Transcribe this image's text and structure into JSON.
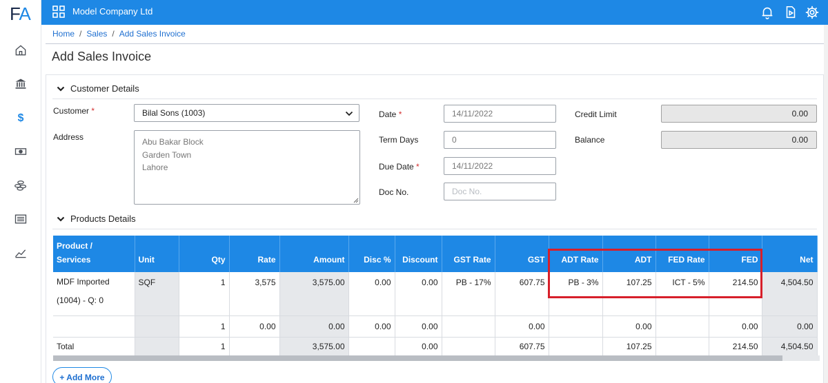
{
  "app": {
    "logo_f": "F",
    "logo_a": "A",
    "company": "Model Company Ltd"
  },
  "nav_icons": [
    "home-icon",
    "bank-icon",
    "dollar-icon",
    "cash-icon",
    "coins-icon",
    "list-icon",
    "chart-icon"
  ],
  "breadcrumb": {
    "home": "Home",
    "sales": "Sales",
    "current": "Add Sales Invoice",
    "sep": "/"
  },
  "page": {
    "title": "Add Sales Invoice"
  },
  "customer_details": {
    "heading": "Customer Details",
    "customer_label": "Customer",
    "customer_value": "Bilal Sons (1003)",
    "address_label": "Address",
    "address_lines": [
      "Abu Bakar Block",
      "Garden Town",
      "Lahore"
    ],
    "date_label": "Date",
    "date_value": "14/11/2022",
    "term_days_label": "Term Days",
    "term_days_value": "0",
    "due_date_label": "Due Date",
    "due_date_value": "14/11/2022",
    "doc_no_label": "Doc No.",
    "doc_no_placeholder": "Doc No.",
    "credit_limit_label": "Credit Limit",
    "credit_limit_value": "0.00",
    "balance_label": "Balance",
    "balance_value": "0.00",
    "required_mark": "*"
  },
  "products": {
    "heading": "Products Details",
    "columns": {
      "product_l1": "Product /",
      "product_l2": "Services",
      "unit": "Unit",
      "qty": "Qty",
      "rate": "Rate",
      "amount": "Amount",
      "disc_pct": "Disc %",
      "discount": "Discount",
      "gst_rate": "GST Rate",
      "gst": "GST",
      "adt_rate": "ADT Rate",
      "adt": "ADT",
      "fed_rate": "FED Rate",
      "fed": "FED",
      "net": "Net"
    },
    "row1": {
      "product_l1": "MDF Imported",
      "product_l2": "(1004) - Q: 0",
      "unit": "SQF",
      "qty": "1",
      "rate": "3,575",
      "amount": "3,575.00",
      "disc_pct": "0.00",
      "discount": "0.00",
      "gst_rate": "PB - 17%",
      "gst": "607.75",
      "adt_rate": "PB - 3%",
      "adt": "107.25",
      "fed_rate": "ICT - 5%",
      "fed": "214.50",
      "net": "4,504.50"
    },
    "row2": {
      "qty": "1",
      "rate": "0.00",
      "amount": "0.00",
      "disc_pct": "0.00",
      "discount": "0.00",
      "gst": "0.00",
      "adt": "0.00",
      "fed": "0.00",
      "net": "0.00"
    },
    "total": {
      "label": "Total",
      "qty": "1",
      "amount": "3,575.00",
      "discount": "0.00",
      "gst": "607.75",
      "adt": "107.25",
      "fed": "214.50",
      "net": "4,504.50"
    },
    "add_more": "+ Add More"
  },
  "colors": {
    "primary": "#1e88e5",
    "highlight": "#d71f2a"
  }
}
